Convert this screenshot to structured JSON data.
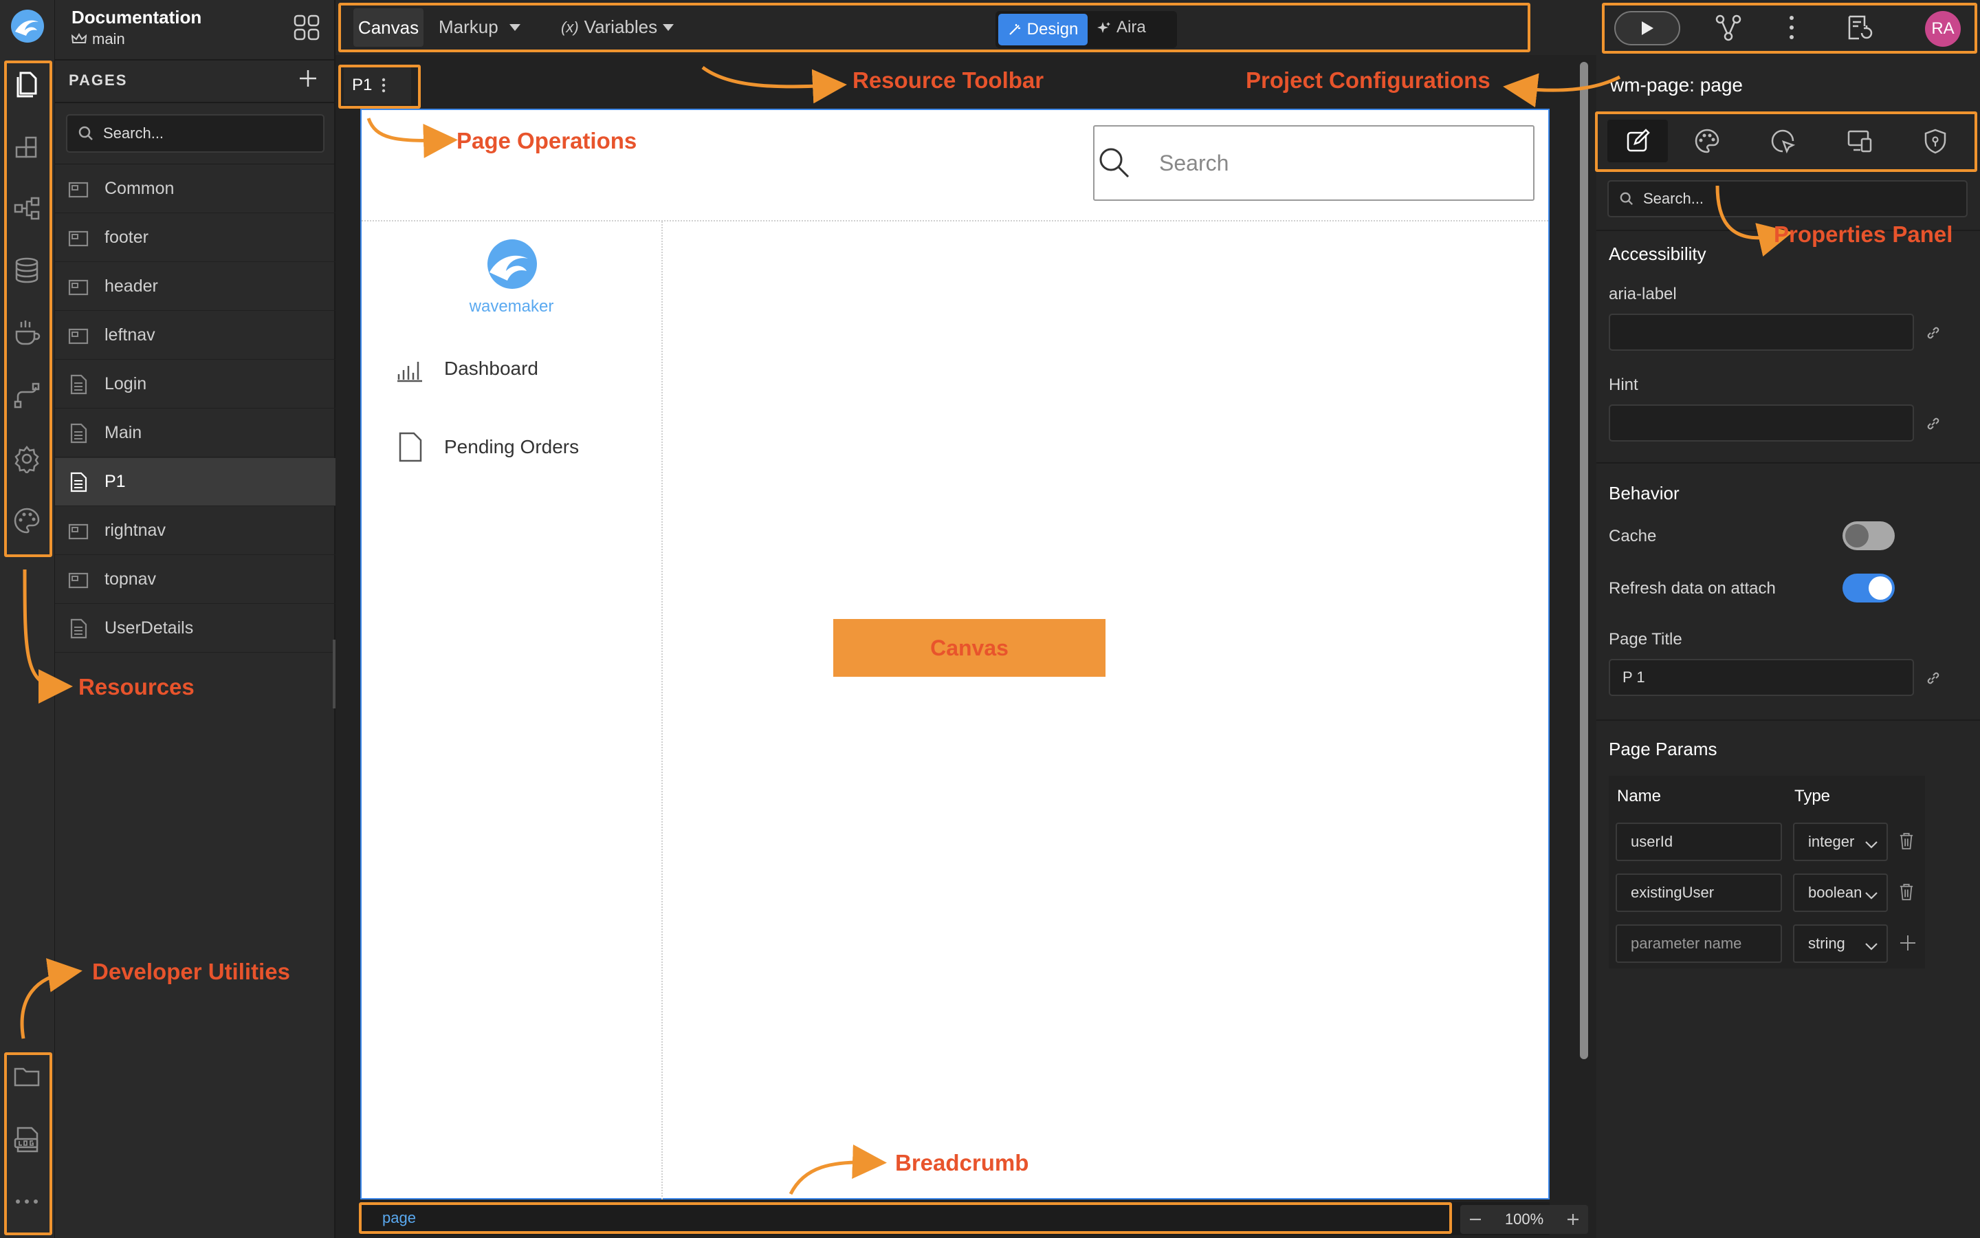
{
  "app": {
    "title": "Documentation",
    "branch": "main"
  },
  "rail": {
    "top_icons": [
      "pages-icon",
      "widgets-icon",
      "structure-icon",
      "database-icon",
      "java-services-icon",
      "api-icon",
      "settings-icon",
      "theme-icon"
    ],
    "bottom_icons": [
      "folder-icon",
      "log-icon",
      "more-icon"
    ]
  },
  "pages": {
    "header": "PAGES",
    "search_placeholder": "Search...",
    "items": [
      {
        "label": "Common",
        "icon": "partial-icon"
      },
      {
        "label": "footer",
        "icon": "partial-icon"
      },
      {
        "label": "header",
        "icon": "partial-icon"
      },
      {
        "label": "leftnav",
        "icon": "partial-icon"
      },
      {
        "label": "Login",
        "icon": "page-icon"
      },
      {
        "label": "Main",
        "icon": "page-icon"
      },
      {
        "label": "P1",
        "icon": "page-icon",
        "selected": true
      },
      {
        "label": "rightnav",
        "icon": "partial-icon"
      },
      {
        "label": "topnav",
        "icon": "partial-icon"
      },
      {
        "label": "UserDetails",
        "icon": "page-icon"
      }
    ]
  },
  "toolbar": {
    "tabs": [
      "Canvas",
      "Markup"
    ],
    "variables_label": "Variables",
    "variables_prefix": "(x)",
    "mode_design": "Design",
    "mode_aira": "Aira"
  },
  "canvas": {
    "page_tab": "P1",
    "search_placeholder": "Search",
    "logo_text": "wavemaker",
    "nav_items": [
      "Dashboard",
      "Pending Orders"
    ],
    "center_label": "Canvas"
  },
  "breadcrumb": {
    "path": "page",
    "zoom": "100%"
  },
  "properties": {
    "title": "wm-page: page",
    "tabs": [
      "edit-icon",
      "style-icon",
      "events-icon",
      "device-icon",
      "security-icon"
    ],
    "search_placeholder": "Search...",
    "accessibility": {
      "title": "Accessibility",
      "aria_label": "aria-label",
      "aria_value": "",
      "hint": "Hint",
      "hint_value": ""
    },
    "behavior": {
      "title": "Behavior",
      "cache": "Cache",
      "cache_on": false,
      "refresh": "Refresh data on attach",
      "refresh_on": true,
      "page_title_label": "Page Title",
      "page_title_value": "P 1"
    },
    "params": {
      "title": "Page Params",
      "col_name": "Name",
      "col_type": "Type",
      "rows": [
        {
          "name": "userId",
          "type": "integer"
        },
        {
          "name": "existingUser",
          "type": "boolean"
        }
      ],
      "new_placeholder": "parameter name",
      "new_type": "string"
    }
  },
  "header_right": {
    "avatar": "RA"
  },
  "annotations": {
    "resource_toolbar": "Resource Toolbar",
    "project_configurations": "Project Configurations",
    "page_operations": "Page Operations",
    "properties_panel": "Properties Panel",
    "resources": "Resources",
    "developer_utilities": "Developer Utilities",
    "breadcrumb": "Breadcrumb"
  },
  "colors": {
    "annotation": "#e8542c",
    "highlight": "#f0942f",
    "accent": "#3a86e8",
    "canvas_label_bg": "#f0963a"
  }
}
